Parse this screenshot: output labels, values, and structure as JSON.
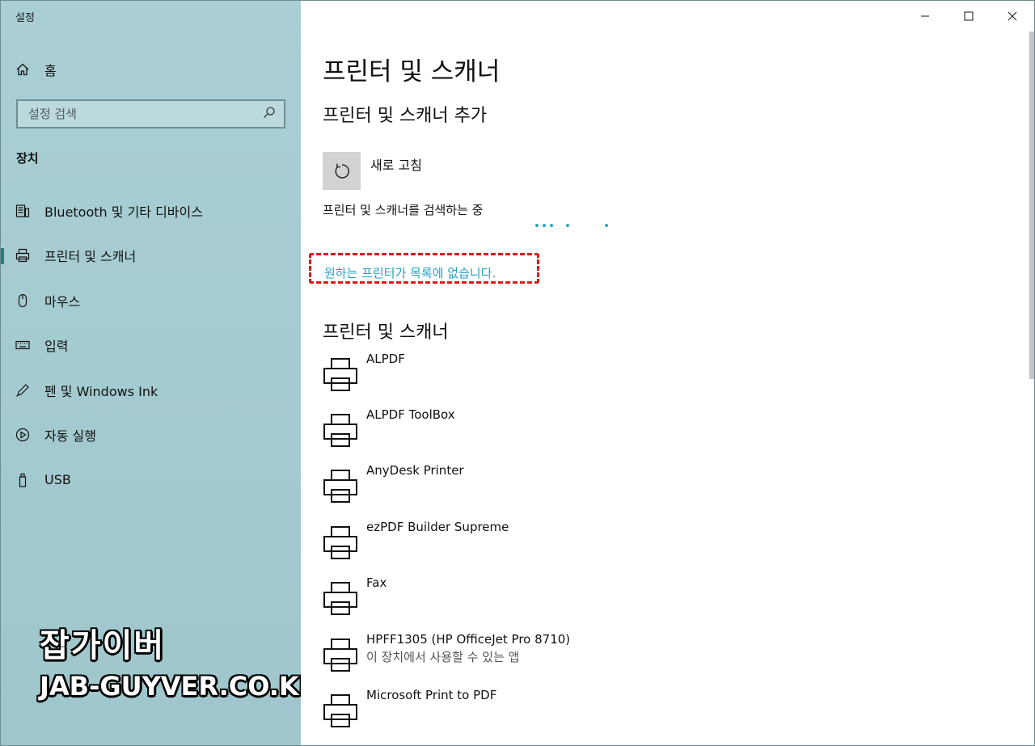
{
  "app": {
    "title": "설정"
  },
  "sidebar": {
    "home_label": "홈",
    "search_placeholder": "설정 검색",
    "section": "장치",
    "items": [
      {
        "label": "Bluetooth 및 기타 디바이스",
        "icon": "bluetooth-devices-icon"
      },
      {
        "label": "프린터 및 스캐너",
        "icon": "printer-icon"
      },
      {
        "label": "마우스",
        "icon": "mouse-icon"
      },
      {
        "label": "입력",
        "icon": "keyboard-icon"
      },
      {
        "label": "펜 및 Windows Ink",
        "icon": "pen-icon"
      },
      {
        "label": "자동 실행",
        "icon": "autoplay-icon"
      },
      {
        "label": "USB",
        "icon": "usb-icon"
      }
    ]
  },
  "watermark": {
    "korean": "잡가이버",
    "english": "JAB-GUYVER.CO.KR"
  },
  "main": {
    "title": "프린터 및 스캐너",
    "add_heading": "프린터 및 스캐너 추가",
    "refresh_label": "새로 고침",
    "searching_text": "프린터 및 스캐너를 검색하는 중",
    "not_listed_link": "원하는 프린터가 목록에 없습니다.",
    "list_heading": "프린터 및 스캐너",
    "printers": [
      {
        "name": "ALPDF",
        "status": ""
      },
      {
        "name": "ALPDF ToolBox",
        "status": ""
      },
      {
        "name": "AnyDesk Printer",
        "status": ""
      },
      {
        "name": "ezPDF Builder Supreme",
        "status": ""
      },
      {
        "name": "Fax",
        "status": ""
      },
      {
        "name": "HPFF1305 (HP OfficeJet Pro 8710)",
        "status": "이 장치에서 사용할 수 있는 앱"
      },
      {
        "name": "Microsoft Print to PDF",
        "status": ""
      }
    ]
  },
  "colors": {
    "accent": "#25a2c4",
    "sidebar_bg": "#a9cfd4",
    "highlight_box": "#e01818"
  }
}
